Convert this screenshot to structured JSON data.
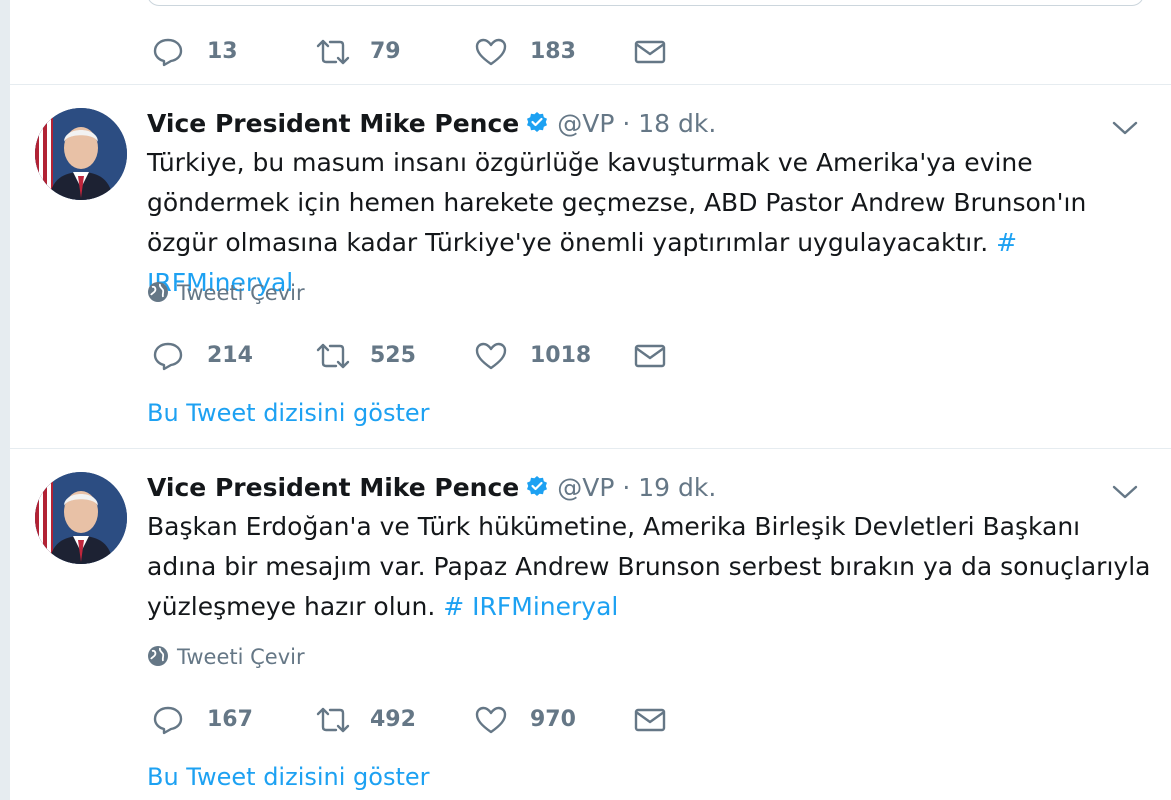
{
  "top_tweet": {
    "replies": "13",
    "retweets": "79",
    "likes": "183"
  },
  "tweets": [
    {
      "name": "Vice President Mike Pence",
      "handle": "@VP",
      "separator": "·",
      "time": "18 dk.",
      "text": "Türkiye, bu masum insanı özgürlüğe kavuşturmak ve Amerika'ya evine göndermek için hemen harekete geçmezse, ABD Pastor Andrew Brunson'ın özgür olmasına kadar Türkiye'ye önemli yaptırımlar uygulayacaktır.",
      "hashtag": "# IRFMineryal",
      "translate_label": "Tweeti Çevir",
      "replies": "214",
      "retweets": "525",
      "likes": "1018",
      "thread_link": "Bu Tweet dizisini göster"
    },
    {
      "name": "Vice President Mike Pence",
      "handle": "@VP",
      "separator": "·",
      "time": "19 dk.",
      "text": "Başkan Erdoğan'a ve Türk hükümetine, Amerika Birleşik Devletleri Başkanı adına bir mesajım var. Papaz Andrew Brunson serbest bırakın ya da sonuçlarıyla yüzleşmeye hazır olun.",
      "hashtag": "# IRFMineryal",
      "translate_label": "Tweeti Çevir",
      "replies": "167",
      "retweets": "492",
      "likes": "970",
      "thread_link": "Bu Tweet dizisini göster"
    }
  ],
  "icons": {
    "reply": "reply-icon",
    "retweet": "retweet-icon",
    "like": "heart-icon",
    "dm": "envelope-icon",
    "verified": "verified-badge-icon",
    "globe": "globe-icon",
    "caret": "chevron-down-icon"
  },
  "colors": {
    "link": "#1da1f2",
    "muted": "#657786",
    "text": "#14171a",
    "background": "#e6ecf0",
    "verified": "#1da1f2"
  }
}
